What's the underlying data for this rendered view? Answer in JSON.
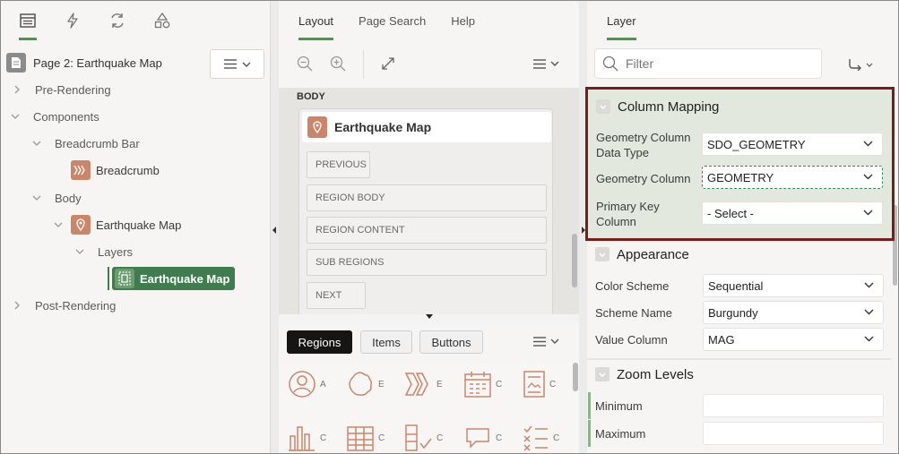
{
  "left": {
    "tabs": [
      {
        "icon": "rendering-tree-icon",
        "active": true
      },
      {
        "icon": "dynamic-actions-icon",
        "active": false
      },
      {
        "icon": "processing-icon",
        "active": false
      },
      {
        "icon": "shared-components-icon",
        "active": false
      }
    ],
    "page_title": "Page 2: Earthquake Map",
    "tree": {
      "pre_rendering": "Pre-Rendering",
      "components": "Components",
      "breadcrumb_bar": "Breadcrumb Bar",
      "breadcrumb": "Breadcrumb",
      "body": "Body",
      "earthquake_map": "Earthquake Map",
      "layers": "Layers",
      "layer_selected": "Earthquake Map",
      "post_rendering": "Post-Rendering"
    }
  },
  "middle": {
    "tabs": [
      "Layout",
      "Page Search",
      "Help"
    ],
    "active_tab": "Layout",
    "canvas": {
      "body_label": "BODY",
      "region_title": "Earthquake Map",
      "slots": [
        "PREVIOUS",
        "REGION BODY",
        "REGION CONTENT",
        "SUB REGIONS",
        "NEXT"
      ]
    },
    "gallery_tabs": [
      "Regions",
      "Items",
      "Buttons"
    ],
    "gallery_active": "Regions",
    "gallery_cut_labels": [
      "A",
      "E",
      "E",
      "C",
      "C",
      "C",
      "C",
      "C",
      "C",
      "C"
    ]
  },
  "right": {
    "tab": "Layer",
    "filter_placeholder": "Filter",
    "sections": {
      "column_mapping": {
        "title": "Column Mapping",
        "geometry_type_label": "Geometry Column Data Type",
        "geometry_type_value": "SDO_GEOMETRY",
        "geometry_column_label": "Geometry Column",
        "geometry_column_value": "GEOMETRY",
        "primary_key_label": "Primary Key Column",
        "primary_key_value": "- Select -"
      },
      "appearance": {
        "title": "Appearance",
        "color_scheme_label": "Color Scheme",
        "color_scheme_value": "Sequential",
        "scheme_name_label": "Scheme Name",
        "scheme_name_value": "Burgundy",
        "value_column_label": "Value Column",
        "value_column_value": "MAG"
      },
      "zoom_levels": {
        "title": "Zoom Levels",
        "minimum_label": "Minimum",
        "minimum_value": "",
        "maximum_label": "Maximum",
        "maximum_value": ""
      }
    }
  },
  "colors": {
    "accent_green": "#5d8a59",
    "selected_node": "#3f7d4f",
    "region_icon": "#c9866b",
    "highlight_border": "#7b1c1c"
  }
}
